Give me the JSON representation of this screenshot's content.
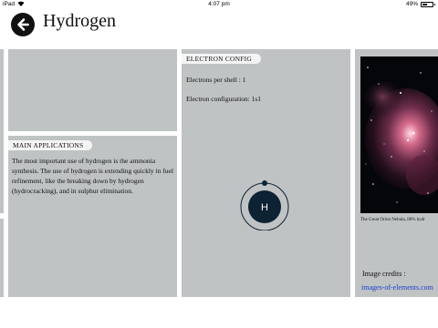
{
  "status_bar": {
    "carrier": "iPad",
    "time": "4:07 pm",
    "battery_percent": "49%",
    "battery_level": 0.49,
    "wifi_icon": "wifi-icon"
  },
  "header": {
    "back_icon": "arrow-left-icon",
    "title": "Hydrogen"
  },
  "applications": {
    "header": "MAIN APPLICATIONS",
    "text": "The most important use of hydrogen is the ammonia synthesis. The use of hydrogen is extending quickly in fuel refinement, like the breaking down by hydrogen (hydrocracking), and in sulphur elimination."
  },
  "electron_config": {
    "header": "ELECTRON CONFIG",
    "electrons_per_shell": "Electrons per shell : 1",
    "configuration": "Electron configuration: 1s1",
    "atom_symbol": "H",
    "shell_count": 1,
    "electron_count": 1
  },
  "image_panel": {
    "caption": "The Great Orion Nebula, 80% hydr",
    "credits_label": "Image credits :",
    "credits_link": "images-of-elements.com"
  },
  "colors": {
    "panel": "#bfc3c3",
    "header_tab": "#f4f4f4",
    "atom_fill": "#0d2233",
    "link": "#1a3fd0"
  }
}
